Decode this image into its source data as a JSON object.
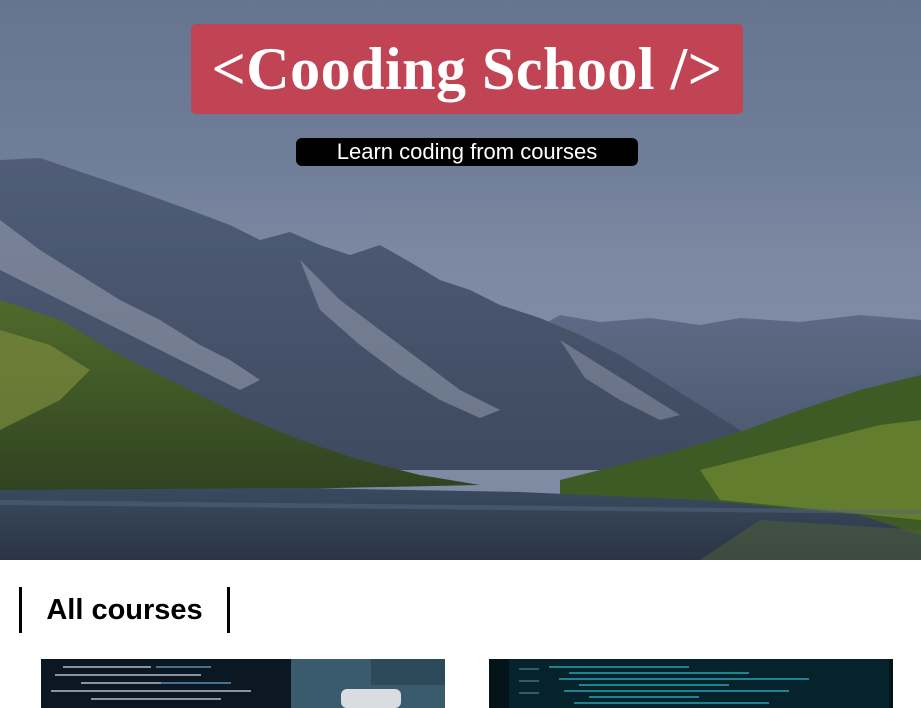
{
  "hero": {
    "brand_title": "<Cooding School />",
    "tagline": "Learn coding from courses"
  },
  "courses": {
    "heading": "All courses"
  }
}
